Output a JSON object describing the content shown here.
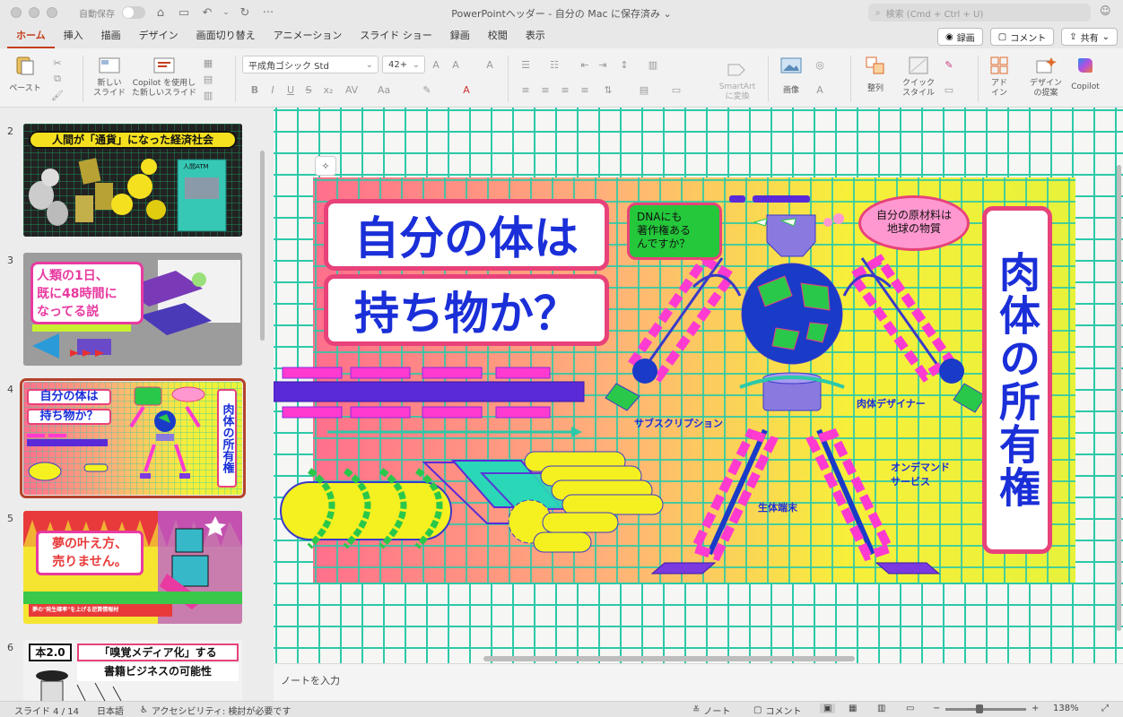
{
  "titlebar": {
    "autosave_label": "自動保存",
    "document_title": "PowerPointヘッダー - 自分の Mac に保存済み",
    "title_chevron": "⌄",
    "search_placeholder": "検索 (Cmd + Ctrl + U)"
  },
  "tabs": [
    "ホーム",
    "挿入",
    "描画",
    "デザイン",
    "画面切り替え",
    "アニメーション",
    "スライド ショー",
    "録画",
    "校閲",
    "表示"
  ],
  "tab_actions": {
    "record": "録画",
    "comment": "コメント",
    "share": "共有"
  },
  "ribbon": {
    "paste": "ペースト",
    "new_slide": "新しい\nスライド",
    "copilot_new_slide": "Copilot を使用し\nた新しいスライド",
    "font_name": "平成角ゴシック Std",
    "font_size": "42+",
    "smartart": "SmartArt\nに変換",
    "picture": "画像",
    "arrange": "整列",
    "quick_style": "クイック\nスタイル",
    "addin": "アド\nイン",
    "design_ideas": "デザイン\nの提案",
    "copilot": "Copilot"
  },
  "slides_panel": {
    "thumbnails": [
      {
        "number": "2",
        "title": "人間が「通貨」になった経済社会",
        "subtitle": "人間ATM"
      },
      {
        "number": "3",
        "title": "人類の1日、既に48時間になってる説",
        "line1": "人類の1日、",
        "line2": "既に48時間に",
        "line3": "なってる説"
      },
      {
        "number": "4",
        "line1": "自分の体は",
        "line2": "持ち物か？",
        "side": "肉体の所有権"
      },
      {
        "number": "5",
        "line1": "夢の叶え方、",
        "line2": "売りません。",
        "footer": "夢の\"発生確率\"を上げる逆算情報材"
      },
      {
        "number": "6",
        "tag": "本2.0",
        "line1": "「嗅覚メディア化」する",
        "line2": "書籍ビジネスの可能性"
      }
    ]
  },
  "slide": {
    "title_line1": "自分の体は",
    "title_line2": "持ち物か？",
    "vertical_title": "肉体の所有権",
    "bubble_dna": "DNAにも\n著作権ある\nんですか？",
    "bubble_earth": "自分の原材料は\n地球の物質",
    "label_subscription": "サブスクリプション",
    "label_designer": "肉体デザイナー",
    "label_ondemand": "オンデマンド\nサービス",
    "label_terminal": "生体端末"
  },
  "notes": {
    "placeholder": "ノートを入力"
  },
  "statusbar": {
    "slide_count": "スライド 4 / 14",
    "language": "日本語",
    "accessibility": "アクセシビリティ: 検討が必要です",
    "notes": "ノート",
    "comments": "コメント",
    "zoom": "138%",
    "zoom_minus": "−",
    "zoom_plus": "+"
  },
  "colors": {
    "accent": "#c43e1c",
    "slide_blue": "#1a2fd8",
    "slide_pink": "#e8427a",
    "grid_teal": "#2cc9a8"
  }
}
